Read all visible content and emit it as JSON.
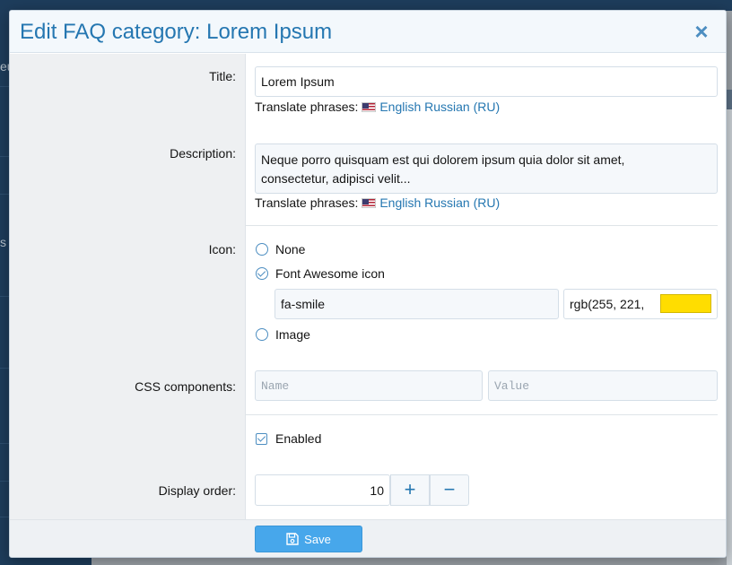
{
  "dialog": {
    "title": "Edit FAQ category: Lorem Ipsum",
    "close_glyph": "×"
  },
  "form": {
    "title": {
      "label": "Title:",
      "value": "Lorem Ipsum",
      "translate_prefix": "Translate phrases:",
      "translate_link": "English Russian (RU)"
    },
    "description": {
      "label": "Description:",
      "line1": "Neque porro quisquam est qui dolorem ipsum quia dolor sit amet,",
      "line2": "consectetur, adipisci velit...",
      "translate_prefix": "Translate phrases:",
      "translate_link": "English Russian (RU)"
    },
    "icon": {
      "label": "Icon:",
      "options": [
        "None",
        "Font Awesome icon",
        "Image"
      ],
      "selected": "Font Awesome icon",
      "fa_value": "fa-smile",
      "color_value": "rgb(255, 221,",
      "swatch_color": "#ffdd00"
    },
    "css_components": {
      "label": "CSS components:",
      "name_placeholder": "Name",
      "value_placeholder": "Value"
    },
    "enabled": {
      "label": "Enabled",
      "checked": true
    },
    "display_order": {
      "label": "Display order:",
      "value": "10",
      "plus": "+",
      "minus": "−"
    }
  },
  "footer": {
    "save_label": "Save"
  },
  "backdrop": {
    "fragment_1": "eu",
    "fragment_2": "s",
    "fragment_3": "s"
  },
  "colors": {
    "accent": "#2577b1",
    "button": "#47a7eb",
    "sidebar": "#1e3d5c"
  }
}
